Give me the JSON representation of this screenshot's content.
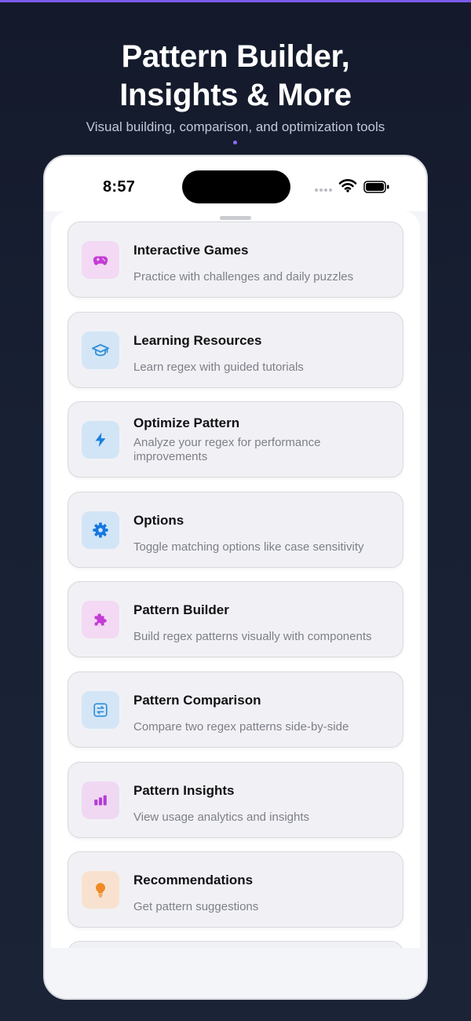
{
  "hero": {
    "title_line1": "Pattern Builder,",
    "title_line2": "Insights & More",
    "subtitle": "Visual building, comparison, and optimization tools"
  },
  "status_bar": {
    "time": "8:57",
    "icons": [
      "cellular-dots-icon",
      "wifi-icon",
      "battery-icon"
    ]
  },
  "menu": {
    "items": [
      {
        "title": "Interactive Games",
        "description": "Practice with challenges and daily puzzles",
        "icon": "gamepad-icon",
        "icon_color": "#c43bd6",
        "icon_bg": "#f3d9f3"
      },
      {
        "title": "Learning Resources",
        "description": "Learn regex with guided tutorials",
        "icon": "graduation-cap-icon",
        "icon_color": "#2f8fd8",
        "icon_bg": "#d4e6f6"
      },
      {
        "title": "Optimize Pattern",
        "description": "Analyze your regex for performance improvements",
        "icon": "bolt-icon",
        "icon_color": "#1b7fe0",
        "icon_bg": "#d2e5f7"
      },
      {
        "title": "Options",
        "description": "Toggle matching options like case sensitivity",
        "icon": "gear-icon",
        "icon_color": "#1677e0",
        "icon_bg": "#d2e5f7"
      },
      {
        "title": "Pattern Builder",
        "description": "Build regex patterns visually with components",
        "icon": "puzzle-icon",
        "icon_color": "#c43bd6",
        "icon_bg": "#f3d9f3"
      },
      {
        "title": "Pattern Comparison",
        "description": "Compare two regex patterns side-by-side",
        "icon": "compare-arrows-icon",
        "icon_color": "#2f8fd8",
        "icon_bg": "#d4e6f6"
      },
      {
        "title": "Pattern Insights",
        "description": "View usage analytics and insights",
        "icon": "bar-chart-icon",
        "icon_color": "#b43cd6",
        "icon_bg": "#f0d8f3"
      },
      {
        "title": "Recommendations",
        "description": "Get pattern suggestions",
        "icon": "lightbulb-icon",
        "icon_color": "#f08a24",
        "icon_bg": "#f8e2cf"
      }
    ]
  },
  "colors": {
    "accent": "#7b5cf0",
    "background": "#141a2b"
  }
}
